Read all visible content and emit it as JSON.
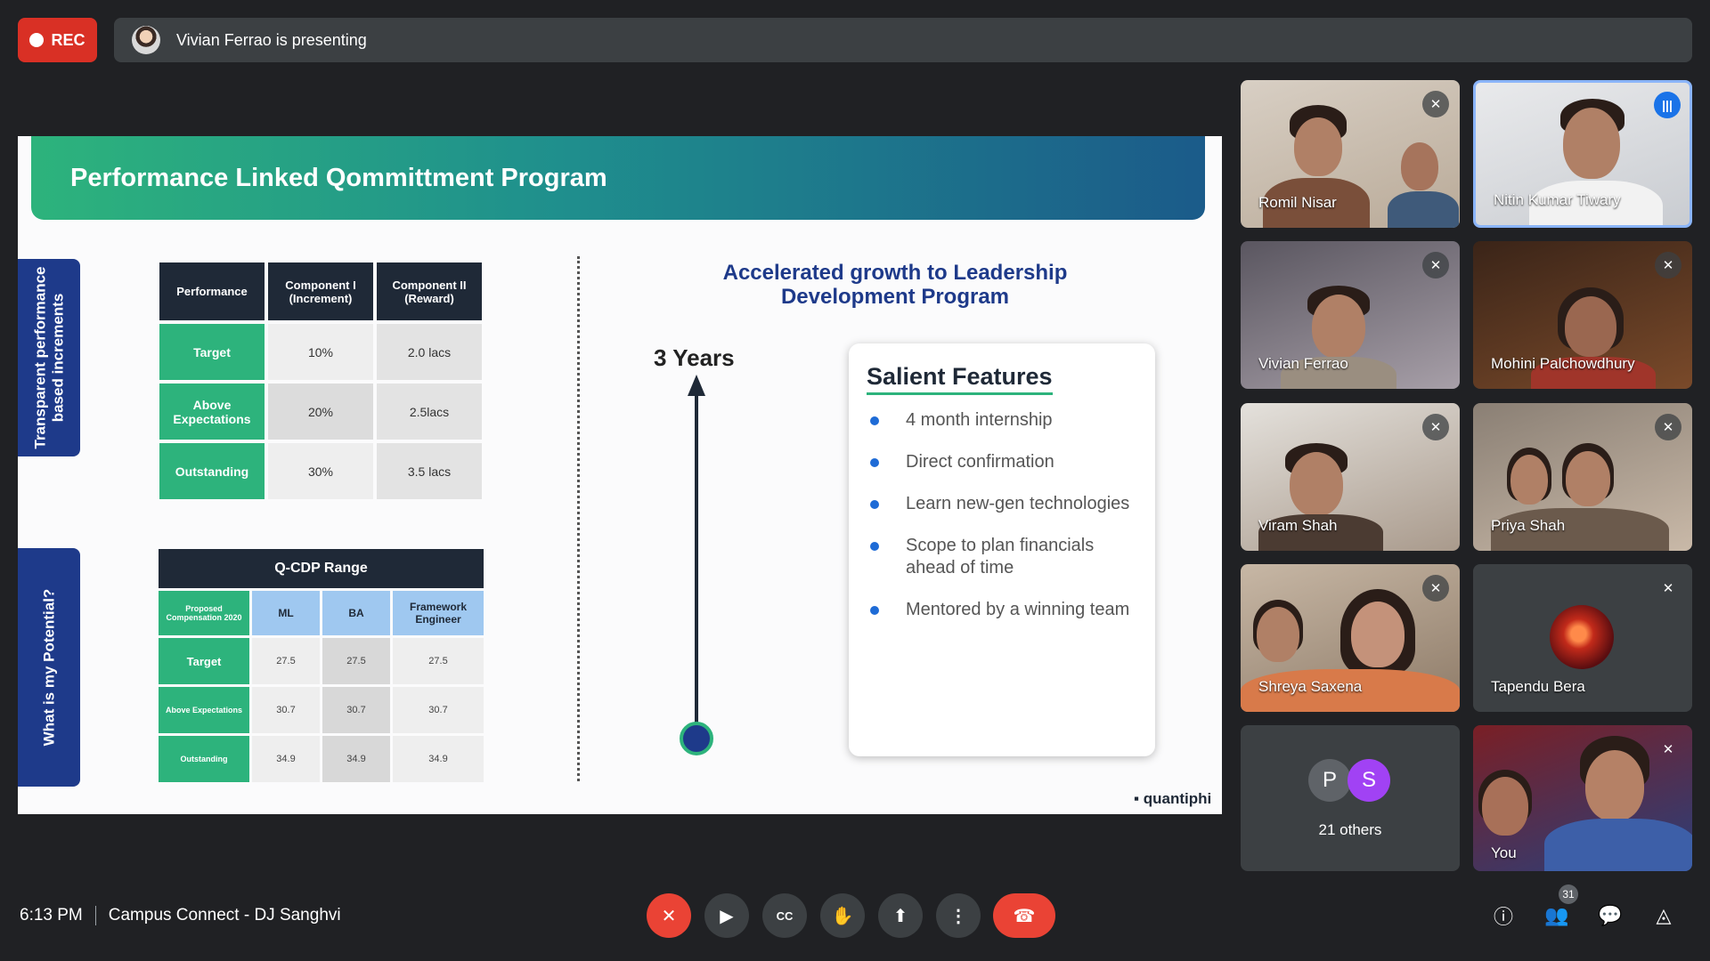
{
  "top": {
    "rec_label": "REC",
    "presenting_text": "Vivian Ferrao is presenting"
  },
  "slide": {
    "title": "Performance Linked Qommittment Program",
    "side_tab_1": "Transparent performance\nbased increments",
    "side_tab_2": "What is my Potential?",
    "perf_table": {
      "headers": [
        "Performance",
        "Component I (Increment)",
        "Component II (Reward)"
      ],
      "rows": [
        [
          "Target",
          "10%",
          "2.0 lacs"
        ],
        [
          "Above Expectations",
          "20%",
          "2.5lacs"
        ],
        [
          "Outstanding",
          "30%",
          "3.5 lacs"
        ]
      ]
    },
    "qcdp_table": {
      "title": "Q-CDP Range",
      "headers": [
        "Proposed Compensation 2020",
        "ML",
        "BA",
        "Framework Engineer"
      ],
      "rows": [
        [
          "Target",
          "27.5",
          "27.5",
          "27.5"
        ],
        [
          "Above Expectations",
          "30.7",
          "30.7",
          "30.7"
        ],
        [
          "Outstanding",
          "34.9",
          "34.9",
          "34.9"
        ]
      ]
    },
    "lead_title": "Accelerated growth to Leadership Development Program",
    "years": "3 Years",
    "features_title": "Salient Features",
    "features": [
      "4 month internship",
      "Direct confirmation",
      "Learn new-gen technologies",
      "Scope to plan financials ahead of time",
      "Mentored by a winning team"
    ],
    "logo": "quantiphi"
  },
  "participants": [
    {
      "name": "Romil Nisar"
    },
    {
      "name": "Nitin Kumar Tiwary"
    },
    {
      "name": "Vivian Ferrao"
    },
    {
      "name": "Mohini Palchowdhury"
    },
    {
      "name": "Viram Shah"
    },
    {
      "name": "Priya Shah"
    },
    {
      "name": "Shreya Saxena"
    },
    {
      "name": "Tapendu Bera"
    },
    {
      "name": "21 others",
      "initials": [
        "P",
        "S"
      ]
    },
    {
      "name": "You"
    }
  ],
  "bottom": {
    "time": "6:13 PM",
    "meeting": "Campus Connect - DJ Sanghvi",
    "people_count": "31"
  },
  "colors": {
    "rec": "#d93025",
    "end_call": "#ea4335",
    "slide_accent": "#2db37c",
    "slide_navy": "#1e3a8a"
  }
}
